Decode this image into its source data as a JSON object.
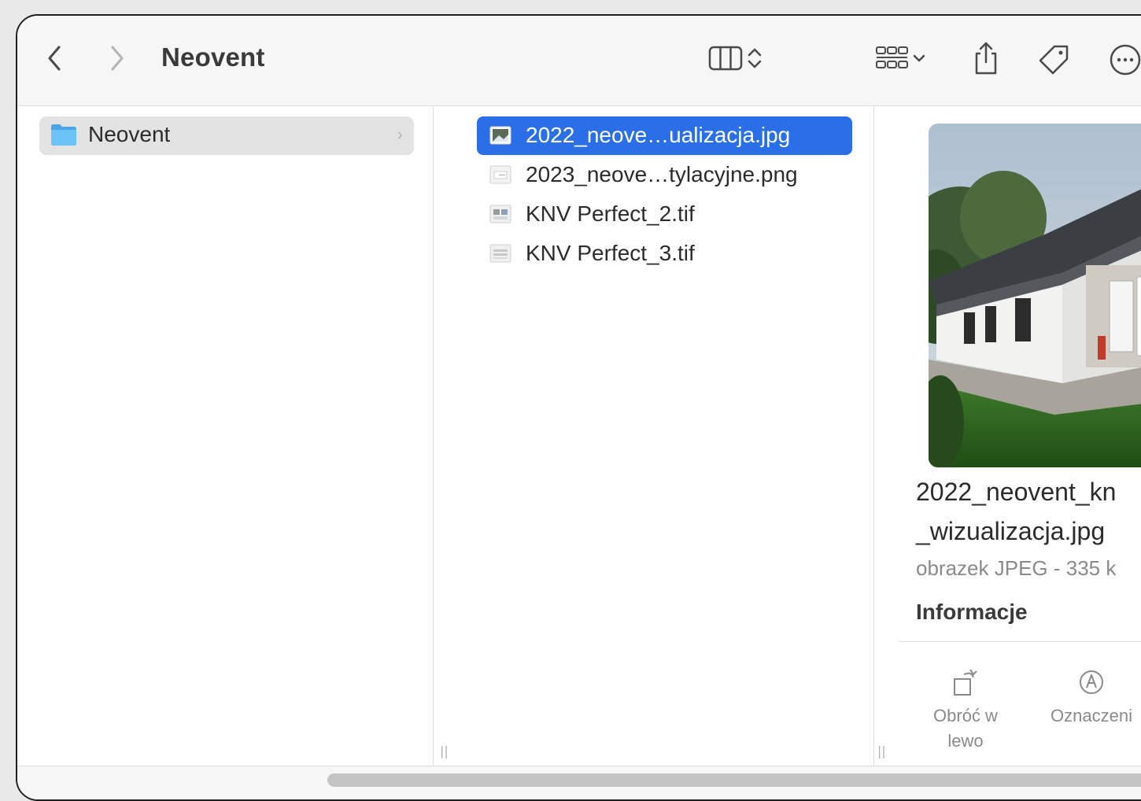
{
  "window": {
    "title": "Neovent"
  },
  "toolbar": {
    "back_icon": "chevron-left-icon",
    "forward_icon": "chevron-right-icon",
    "view_icon": "column-view-icon",
    "group_icon": "group-grid-icon",
    "share_icon": "share-icon",
    "tag_icon": "tag-icon",
    "more_icon": "ellipsis-circle-icon"
  },
  "sidebar": {
    "items": [
      {
        "label": "Neovent",
        "icon": "folder-icon",
        "selected": true
      }
    ]
  },
  "files": [
    {
      "name": "2022_neove…ualizacja.jpg",
      "selected": true,
      "icon": "jpg-file-icon"
    },
    {
      "name": "2023_neove…tylacyjne.png",
      "selected": false,
      "icon": "png-file-icon"
    },
    {
      "name": "KNV Perfect_2.tif",
      "selected": false,
      "icon": "tif-file-icon"
    },
    {
      "name": "KNV Perfect_3.tif",
      "selected": false,
      "icon": "tif-file-icon"
    }
  ],
  "preview": {
    "name_line1": "2022_neovent_kn",
    "name_line2": "_wizualizacja.jpg",
    "kind": "obrazek JPEG - 335 k",
    "info_heading": "Informacje",
    "actions": [
      {
        "label_line1": "Obróć w",
        "label_line2": "lewo",
        "icon": "rotate-left-icon"
      },
      {
        "label_line1": "Oznaczeni",
        "label_line2": "",
        "icon": "markup-icon"
      }
    ]
  },
  "colors": {
    "selection": "#2a6fe8",
    "sidebar_selection": "#e3e3e3",
    "folder": "#5db7f0"
  }
}
